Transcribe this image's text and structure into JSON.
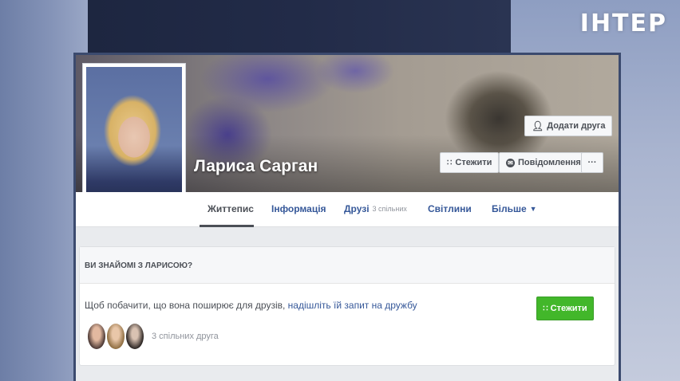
{
  "channel": {
    "logo_text": "ІНТЕР"
  },
  "profile": {
    "name": "Лариса Сарган",
    "add_friend_label": "Додати друга",
    "follow_label": "Стежити",
    "message_label": "Повідомлення",
    "more_label": "···"
  },
  "nav": {
    "tabs": [
      {
        "label": "Життепис"
      },
      {
        "label": "Інформація"
      },
      {
        "label": "Друзі",
        "count": "3 спільних"
      },
      {
        "label": "Світлини"
      },
      {
        "label": "Більше"
      }
    ]
  },
  "know_card": {
    "header": "Ви знайомі з Ларисою?",
    "text": "Щоб побачити, що вона поширює для друзів,",
    "link_text": "надішліть їй запит на дружбу",
    "follow_label": "Стежити",
    "mutual_text": "3 спільних друга"
  },
  "icons": {
    "follow": "rss-icon",
    "message": "messenger-icon",
    "add_friend": "add-person-icon",
    "more_dropdown": "caret-down-icon"
  },
  "colors": {
    "link": "#365899",
    "follow_green": "#42b72a",
    "channel_bg": "#3c4d75"
  }
}
